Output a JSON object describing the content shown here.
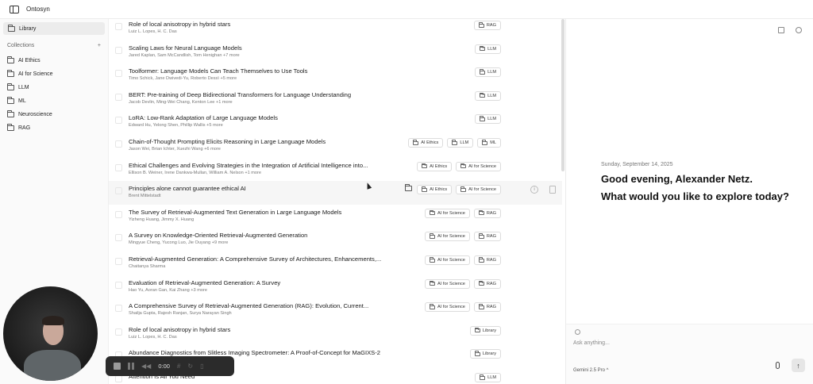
{
  "app": {
    "title": "Ontosyn"
  },
  "sidebar": {
    "library_label": "Library",
    "collections_label": "Collections",
    "add_label": "+",
    "collections": [
      "AI Ethics",
      "AI for Science",
      "LLM",
      "ML",
      "Neuroscience",
      "RAG"
    ]
  },
  "papers": [
    {
      "title": "Role of local anisotropy in hybrid stars",
      "authors": "Luiz L. Lopes, H. C. Das",
      "tags": [
        "RAG"
      ]
    },
    {
      "title": "Scaling Laws for Neural Language Models",
      "authors": "Jared Kaplan, Sam McCandlish, Tom Henighan +7 more",
      "tags": [
        "LLM"
      ]
    },
    {
      "title": "Toolformer: Language Models Can Teach Themselves to Use Tools",
      "authors": "Timo Schick, Jane Dwivedi-Yu, Roberto Dessì +5 more",
      "tags": [
        "LLM"
      ]
    },
    {
      "title": "BERT: Pre-training of Deep Bidirectional Transformers for Language Understanding",
      "authors": "Jacob Devlin, Ming-Wei Chang, Kenton Lee +1 more",
      "tags": [
        "LLM"
      ]
    },
    {
      "title": "LoRA: Low-Rank Adaptation of Large Language Models",
      "authors": "Edward Hu, Yelong Shen, Phillip Wallis +5 more",
      "tags": [
        "LLM"
      ]
    },
    {
      "title": "Chain-of-Thought Prompting Elicits Reasoning in Large Language Models",
      "authors": "Jason Wei, Brian Ichter, Xuezhi Wang +6 more",
      "tags": [
        "AI Ethics",
        "LLM",
        "ML"
      ]
    },
    {
      "title": "Ethical Challenges and Evolving Strategies in the Integration of Artificial Intelligence into...",
      "authors": "Ellison B. Weiner, Irene Dankwa-Mullan, William A. Nelson +1 more",
      "tags": [
        "AI Ethics",
        "AI for Science"
      ]
    },
    {
      "title": "Principles alone cannot guarantee ethical AI",
      "authors": "Brent Mittelstadt",
      "tags": [
        "AI Ethics",
        "AI for Science"
      ],
      "hover": true
    },
    {
      "title": "The Survey of Retrieval-Augmented Text Generation in Large Language Models",
      "authors": "Yizheng Huang, Jimmy X. Huang",
      "tags": [
        "AI for Science",
        "RAG"
      ]
    },
    {
      "title": "A Survey on Knowledge-Oriented Retrieval-Augmented Generation",
      "authors": "Mingyue Cheng, Yucong Luo, Jie Ouyang +9 more",
      "tags": [
        "AI for Science",
        "RAG"
      ]
    },
    {
      "title": "Retrieval-Augmented Generation: A Comprehensive Survey of Architectures, Enhancements,...",
      "authors": "Chaitanya Sharma",
      "tags": [
        "AI for Science",
        "RAG"
      ]
    },
    {
      "title": "Evaluation of Retrieval-Augmented Generation: A Survey",
      "authors": "Hao Yu, Aoran Gan, Kai Zhang +3 more",
      "tags": [
        "AI for Science",
        "RAG"
      ]
    },
    {
      "title": "A Comprehensive Survey of Retrieval-Augmented Generation (RAG): Evolution, Current...",
      "authors": "Shailja Gupta, Rajesh Ranjan, Surya Narayan Singh",
      "tags": [
        "AI for Science",
        "RAG"
      ]
    },
    {
      "title": "Role of local anisotropy in hybrid stars",
      "authors": "Luiz L. Lopes, H. C. Das",
      "tags": [
        "Library"
      ]
    },
    {
      "title": "Abundance Diagnostics from Slitless Imaging Spectrometer: A Proof-of-Concept for MaGIXS-2",
      "authors": "...ay",
      "tags": [
        "Library"
      ]
    },
    {
      "title": "Attention Is All You Need",
      "authors": "",
      "tags": [
        "LLM"
      ]
    }
  ],
  "row_actions": {
    "info": "i",
    "delete": "⌫"
  },
  "chat": {
    "date": "Sunday, September 14, 2025",
    "greeting_line1": "Good evening, Alexander Netz.",
    "greeting_line2": "What would you like to explore today?",
    "placeholder": "Ask anything...",
    "model": "Gemini 2.5 Pro ^",
    "send_label": "↑"
  },
  "recorder": {
    "time": "0:00"
  }
}
